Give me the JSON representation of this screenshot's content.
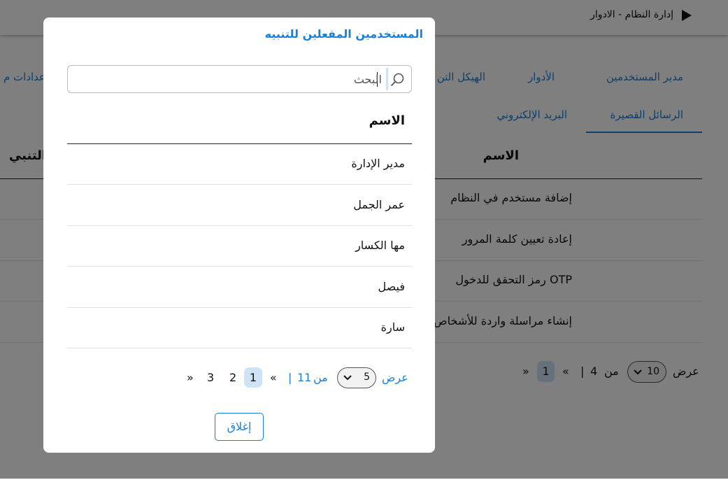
{
  "breadcrumb": {
    "text": "إدارة النظام - الادوار"
  },
  "tabs_row1": [
    {
      "label": "مدير المستخدمين"
    },
    {
      "label": "الأدوار"
    },
    {
      "label": "الهيكل التن"
    },
    {
      "label": "عدادات م"
    }
  ],
  "tabs_row2": [
    {
      "label": "الرسائل القصيرة",
      "active": true
    },
    {
      "label": "البريد الإلكتروني"
    }
  ],
  "background_table": {
    "headers": {
      "name": "الاسم",
      "notify": "ة التنبي"
    },
    "rows": [
      "إضافة مستخدم في النظام",
      "إعادة تعيين كلمة المرور",
      "OTP رمز التحقق للدخول",
      "إنشاء مراسلة واردة للأشخاص المر"
    ],
    "pager": {
      "show_label": "عرض",
      "page_size": "10",
      "of_label": "من",
      "total_pages": "4",
      "separator": "|",
      "prev": "«",
      "current_page": "1",
      "next": "»"
    }
  },
  "modal": {
    "title": "المستخدمين المفعلين للتنبيه",
    "search": {
      "placeholder": "البحث",
      "value": ""
    },
    "column_header": "الاسم",
    "rows": [
      "مدير الإدارة",
      "عمر الجمل",
      "مها الكسار",
      "فيصل",
      "سارة"
    ],
    "pager": {
      "show_label": "عرض",
      "page_size": "5",
      "of_label": "من",
      "total_pages": "11",
      "separator": "|",
      "prev": "«",
      "pages": [
        "1",
        "2",
        "3"
      ],
      "current_page": "1",
      "next": "»"
    },
    "close_label": "إغلاق"
  },
  "colors": {
    "accent": "#1a7fd6",
    "active_page_bg": "#cfe3f6",
    "overlay": "rgba(0,0,0,0.5)"
  }
}
